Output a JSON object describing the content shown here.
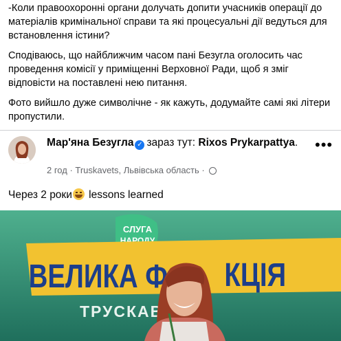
{
  "post": {
    "paragraphs": [
      "-Коли правоохоронні органи долучать допити учасників операції до матеріалів кримінальної справи та які процесуальні дії ведуться для встановлення істини?",
      "Сподіваюсь, що найближчим часом пані Безугла оголосить час проведення комісії у приміщенні Верховної Ради, щоб я зміг відповісти на поставлені нею питання.",
      "Фото вийшло дуже символічне - як кажуть, додумайте самі які літери пропустили."
    ]
  },
  "shared_post": {
    "author": "Мар'яна Безугла",
    "verified_icon": "verified-badge-icon",
    "status_prefix": "зараз тут: ",
    "place": "Rixos Prykarpattya",
    "place_suffix": ".",
    "time": "2 год",
    "location": "Truskavets, Львівська область",
    "separator": " · ",
    "menu_label": "•••",
    "caption_before": "Через 2 роки",
    "caption_emoji": "grinning-sweat-emoji",
    "caption_after": " lessons learned"
  },
  "photo": {
    "badge_line1": "СЛУГА",
    "badge_line2": "НАРОДУ",
    "banner_text": "ВЕЛИКА Ф",
    "banner_text_2": "КЦІЯ",
    "sub_text": "ТРУСКАВ",
    "colors": {
      "background": "#2f8b72",
      "banner": "#f2c230",
      "badge": "#3fbf86"
    }
  }
}
